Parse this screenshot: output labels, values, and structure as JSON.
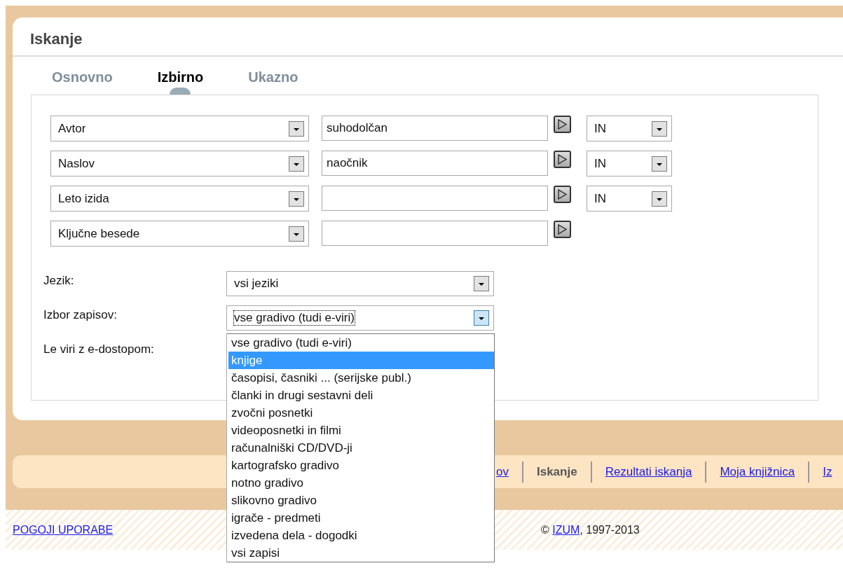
{
  "title": "Iskanje",
  "tabs": [
    {
      "label": "Osnovno",
      "selected": false
    },
    {
      "label": "Izbirno",
      "selected": true
    },
    {
      "label": "Ukazno",
      "selected": false
    }
  ],
  "search_rows": [
    {
      "field": "Avtor",
      "term": "suhodolčan",
      "operator": "IN"
    },
    {
      "field": "Naslov",
      "term": "naočnik",
      "operator": "IN"
    },
    {
      "field": "Leto izida",
      "operator": "IN"
    },
    {
      "field": "Ključne besede"
    }
  ],
  "filters": [
    {
      "label": "Jezik:",
      "value": "vsi jeziki",
      "focused": false
    },
    {
      "label": "Izbor zapisov:",
      "value": "vse gradivo (tudi e-viri)",
      "focused": true
    },
    {
      "label": "Le viri z e-dostopom:"
    }
  ],
  "dropdown": {
    "options": [
      {
        "label": "vse gradivo (tudi e-viri)",
        "selected": false
      },
      {
        "label": "knjige",
        "selected": true
      },
      {
        "label": "časopisi, časniki ... (serijske publ.)",
        "selected": false
      },
      {
        "label": "članki in drugi sestavni deli",
        "selected": false
      },
      {
        "label": "zvočni posnetki",
        "selected": false
      },
      {
        "label": "videoposnetki in filmi",
        "selected": false
      },
      {
        "label": "računalniški CD/DVD-ji",
        "selected": false
      },
      {
        "label": "kartografsko gradivo",
        "selected": false
      },
      {
        "label": "notno gradivo",
        "selected": false
      },
      {
        "label": "slikovno gradivo",
        "selected": false
      },
      {
        "label": "igrače - predmeti",
        "selected": false
      },
      {
        "label": "izvedena dela - dogodki",
        "selected": false
      },
      {
        "label": "vsi zapisi",
        "selected": false
      }
    ]
  },
  "nav": [
    {
      "label": "ov",
      "current": false
    },
    {
      "label": "Iskanje",
      "current": true
    },
    {
      "label": "Rezultati iskanja",
      "current": false
    },
    {
      "label": "Moja knjižnica",
      "current": false
    },
    {
      "label": "Iz",
      "current": false
    }
  ],
  "footer": {
    "terms_link": "POGOJI UPORABE",
    "copyright": {
      "prefix": "© ",
      "link": "IZUM",
      "suffix": ", 1997-2013"
    }
  }
}
